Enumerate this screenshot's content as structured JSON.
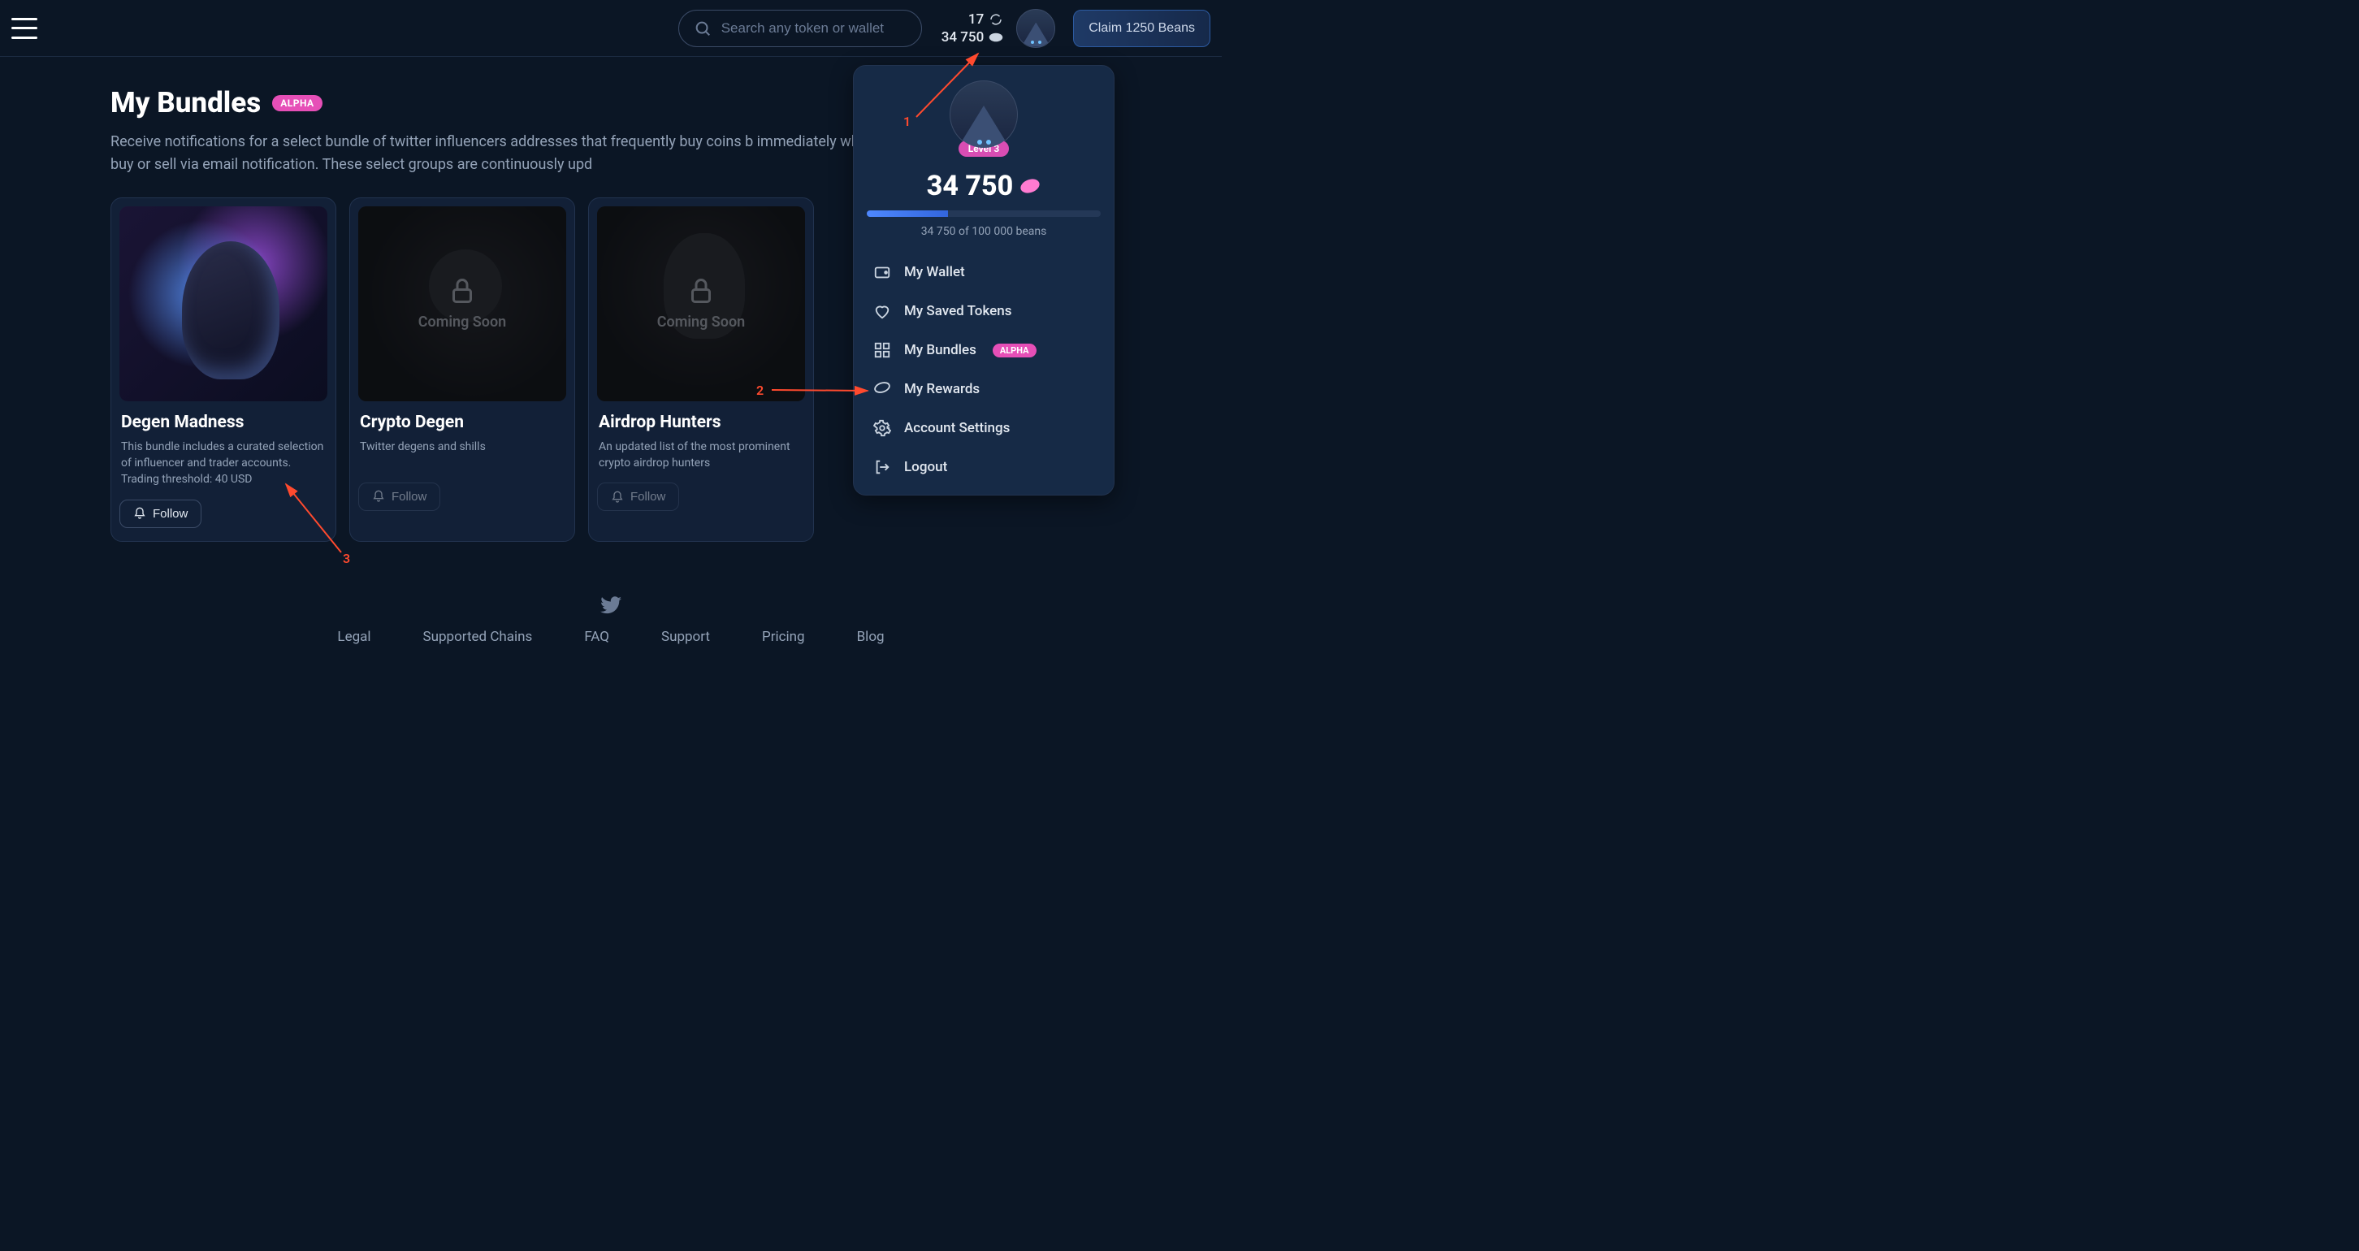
{
  "header": {
    "search_placeholder": "Search any token or wallet",
    "streak_count": "17",
    "bean_count": "34 750",
    "claim_label": "Claim 1250 Beans"
  },
  "page": {
    "title": "My Bundles",
    "title_badge": "ALPHA",
    "subtitle": "Receive notifications for a select bundle of twitter influencers addresses that frequently buy coins b\nimmediately when they buy or sell via email notification. These select groups are continuously upd"
  },
  "cards": [
    {
      "title": "Degen Madness",
      "desc": "This bundle includes a curated selection of influencer and trader accounts. Trading threshold: 40 USD",
      "follow_label": "Follow",
      "locked": false
    },
    {
      "title": "Crypto Degen",
      "desc": "Twitter degens and shills",
      "follow_label": "Follow",
      "locked": true,
      "lock_label": "Coming Soon"
    },
    {
      "title": "Airdrop Hunters",
      "desc": "An updated list of the most prominent crypto airdrop hunters",
      "follow_label": "Follow",
      "locked": true,
      "lock_label": "Coming Soon"
    }
  ],
  "dropdown": {
    "level_label": "Level 3",
    "beans_display": "34 750",
    "progress_pct": 34.75,
    "progress_text": "34 750 of 100 000 beans",
    "menu": [
      {
        "icon": "wallet-icon",
        "label": "My Wallet"
      },
      {
        "icon": "heart-icon",
        "label": "My Saved Tokens"
      },
      {
        "icon": "grid-icon",
        "label": "My Bundles",
        "badge": "ALPHA"
      },
      {
        "icon": "bean-icon",
        "label": "My Rewards"
      },
      {
        "icon": "gear-icon",
        "label": "Account Settings"
      },
      {
        "icon": "logout-icon",
        "label": "Logout"
      }
    ]
  },
  "footer": {
    "links": [
      "Legal",
      "Supported Chains",
      "FAQ",
      "Support",
      "Pricing",
      "Blog"
    ]
  },
  "annotations": {
    "1": "1",
    "2": "2",
    "3": "3"
  }
}
